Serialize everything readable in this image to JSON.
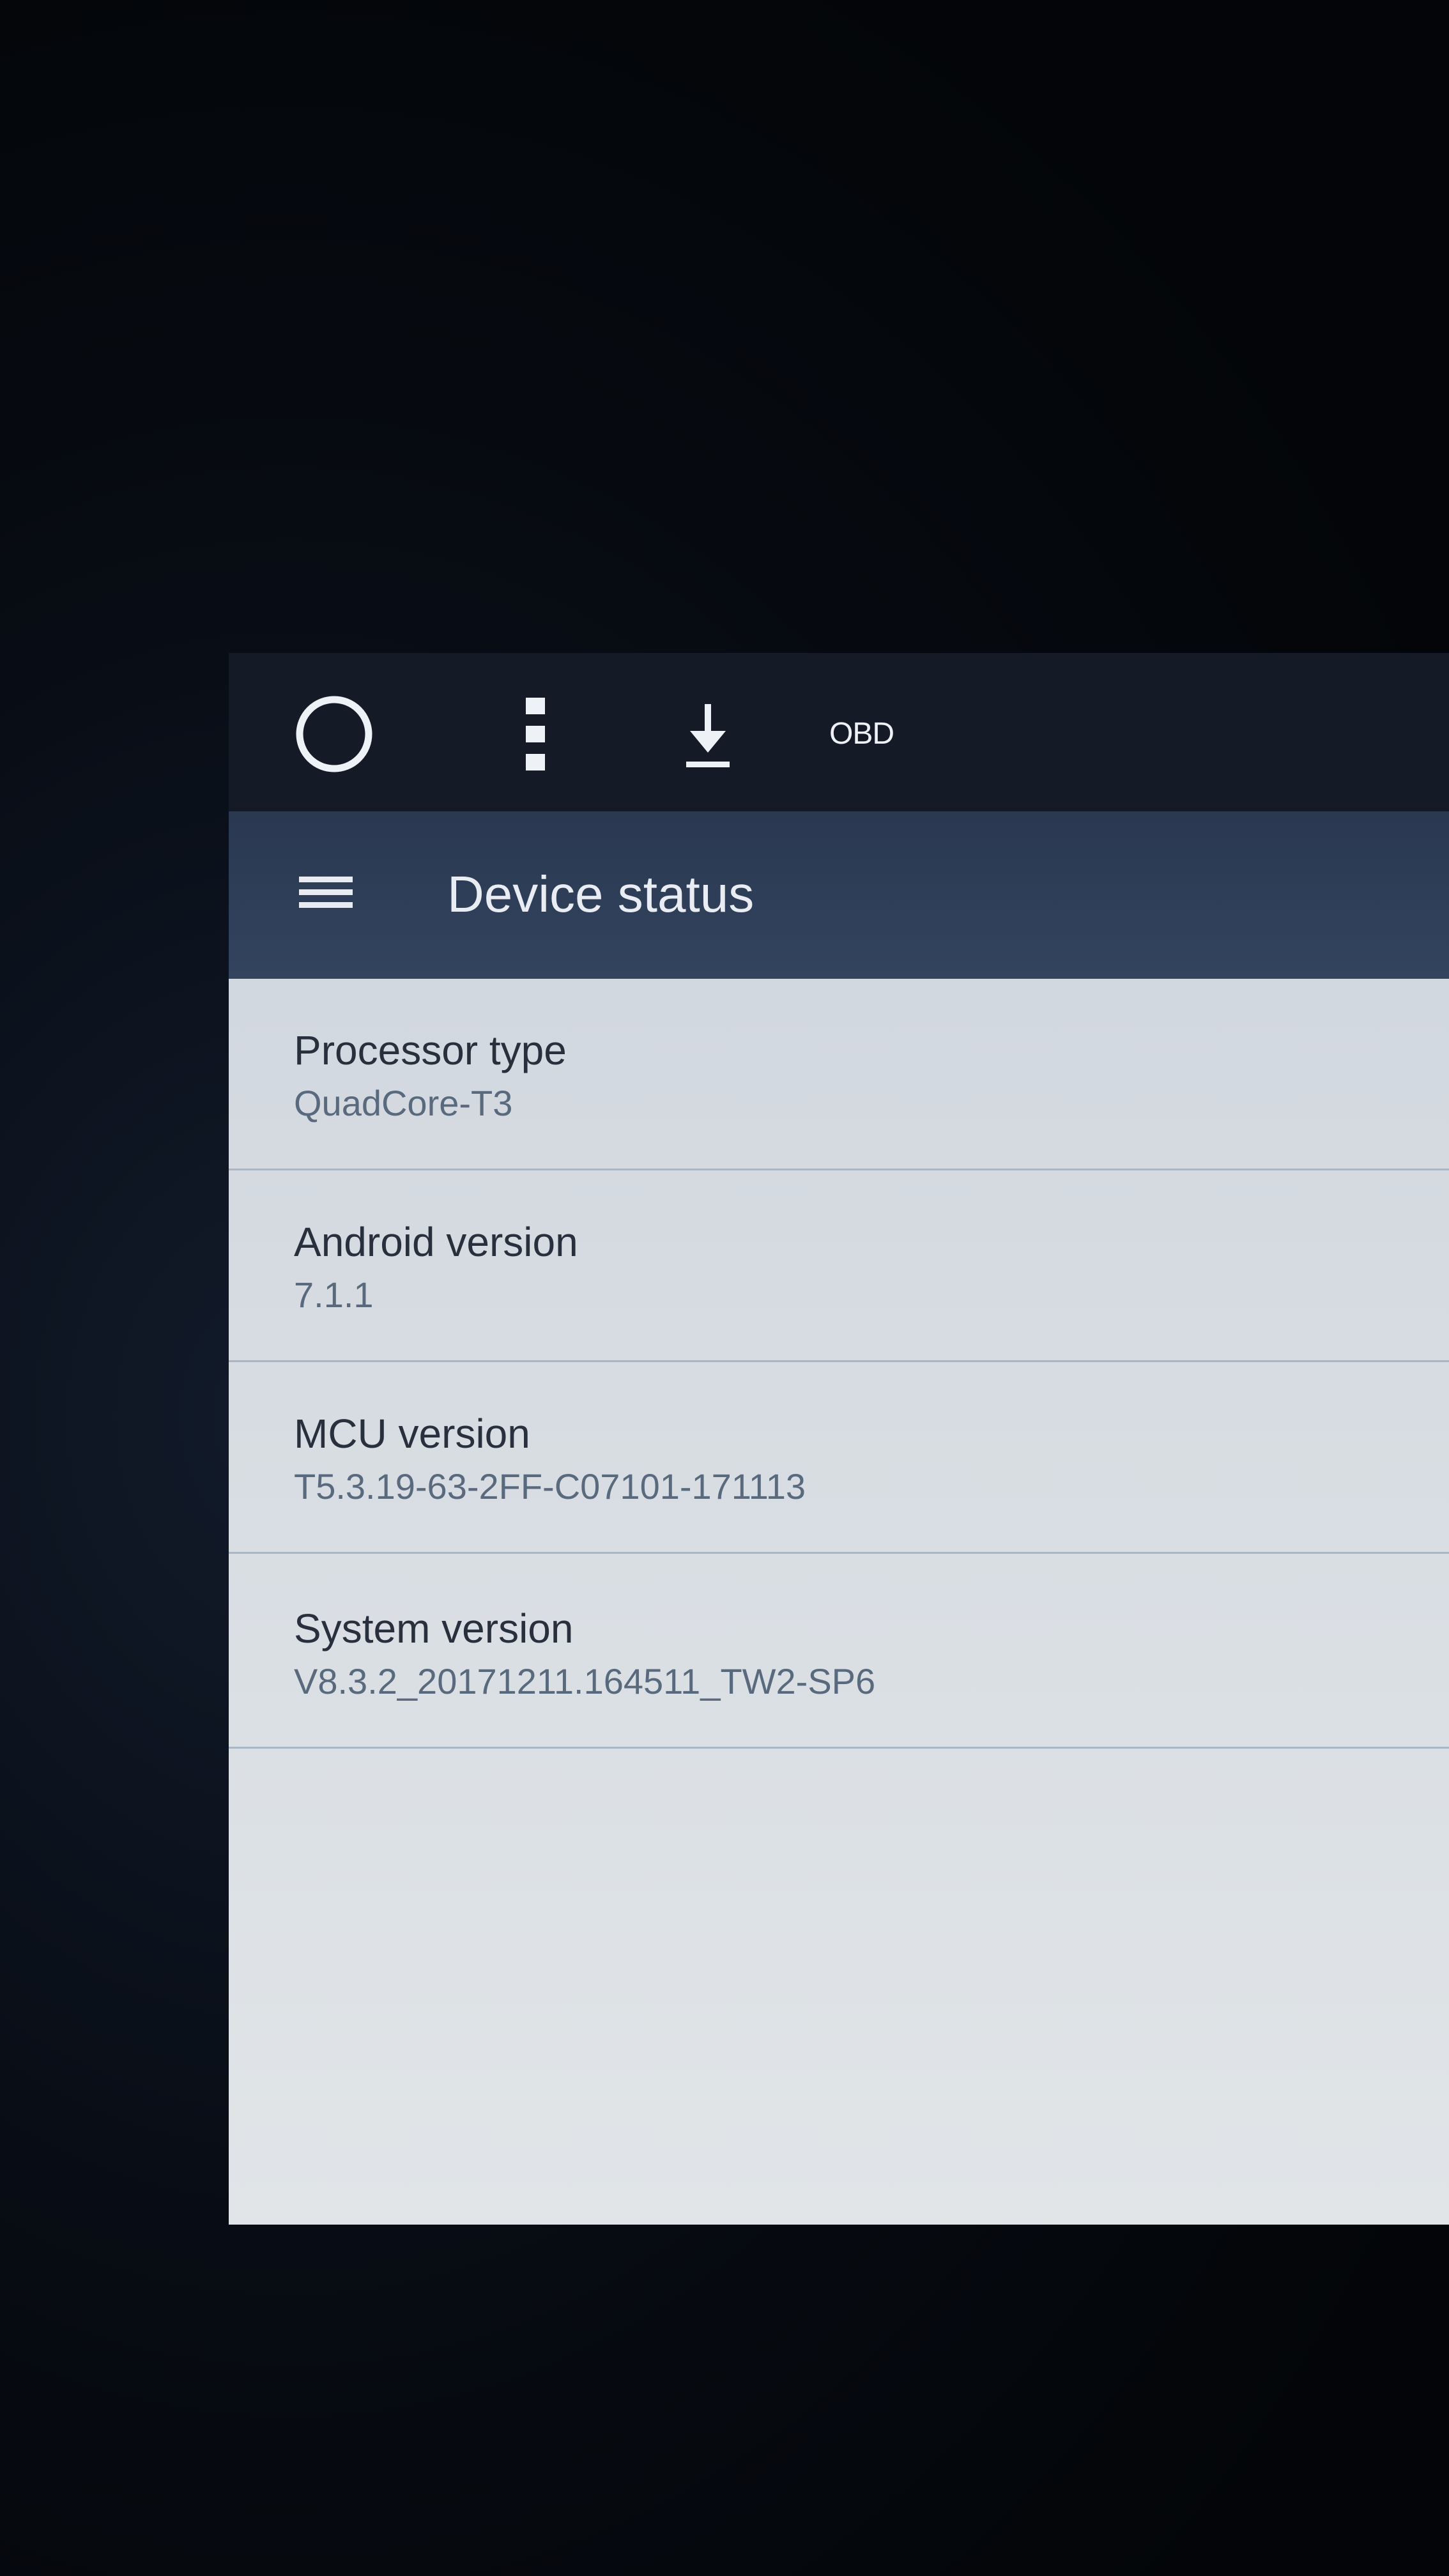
{
  "status_bar": {
    "home_icon": "circle-home-icon",
    "menu_icon": "vertical-dots-icon",
    "download_icon": "download-arrow-icon",
    "obd_label": "OBD"
  },
  "app_bar": {
    "menu_icon": "hamburger-menu-icon",
    "title": "Device status"
  },
  "items": [
    {
      "label": "Processor type",
      "value": "QuadCore-T3"
    },
    {
      "label": "Android version",
      "value": "7.1.1"
    },
    {
      "label": "MCU version",
      "value": "T5.3.19-63-2FF-C07101-171113"
    },
    {
      "label": "System version",
      "value": "V8.3.2_20171211.164511_TW2-SP6"
    }
  ],
  "colors": {
    "status_bar_bg": "#151b26",
    "app_bar_bg": "#2f3f58",
    "content_bg": "#d8dde3",
    "title_text": "#27303c",
    "value_text": "#5a6a7e",
    "divider": "#a9b6c6"
  }
}
